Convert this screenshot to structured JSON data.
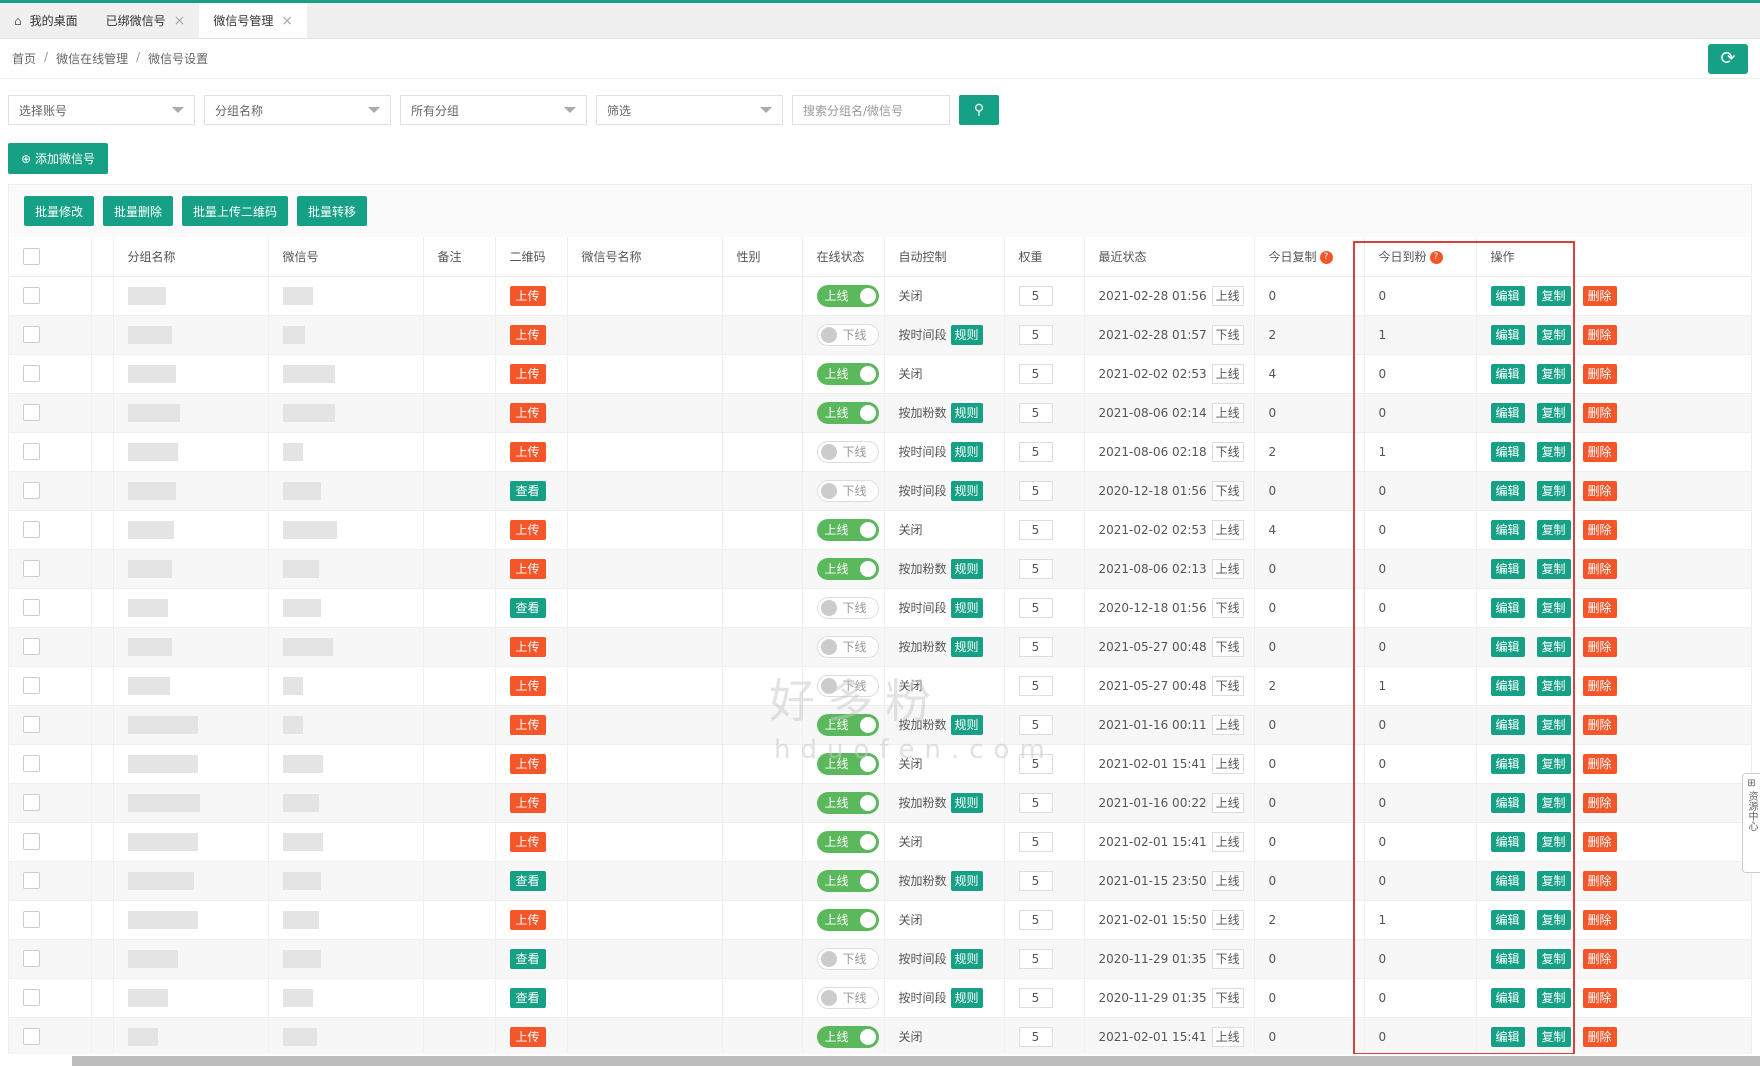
{
  "tabs": [
    {
      "label": "我的桌面",
      "icon": "home-icon",
      "closable": false,
      "active": false
    },
    {
      "label": "已绑微信号",
      "closable": true,
      "active": false
    },
    {
      "label": "微信号管理",
      "closable": true,
      "active": true
    }
  ],
  "breadcrumb": [
    "首页",
    "微信在线管理",
    "微信号设置"
  ],
  "filters": {
    "account": "选择账号",
    "group_name": "分组名称",
    "all_groups": "所有分组",
    "filter": "筛选",
    "search_placeholder": "搜索分组名/微信号"
  },
  "add_button": "添加微信号",
  "batch": {
    "edit": "批量修改",
    "delete": "批量删除",
    "upload_qr": "批量上传二维码",
    "transfer": "批量转移"
  },
  "columns": {
    "group": "分组名称",
    "wechat": "微信号",
    "remark": "备注",
    "qr": "二维码",
    "name": "微信号名称",
    "gender": "性别",
    "online": "在线状态",
    "auto": "自动控制",
    "weight": "权重",
    "recent": "最近状态",
    "today_copy": "今日复制",
    "today_fans": "今日到粉",
    "ops": "操作"
  },
  "labels": {
    "rule": "规则",
    "edit": "编辑",
    "copy": "复制",
    "delete": "删除",
    "upload": "上传",
    "view": "查看",
    "online": "上线",
    "offline": "下线"
  },
  "watermark": {
    "cn": "好多粉",
    "en": "hduofen.com"
  },
  "side_widget": "资源中心",
  "rows": [
    {
      "qr": "上传",
      "online": "上线",
      "auto": "关闭",
      "rule": false,
      "weight": "5",
      "time": "2021-02-28 01:56",
      "status": "上线",
      "copy": "0",
      "fans": "0"
    },
    {
      "qr": "上传",
      "online": "下线",
      "auto": "按时间段",
      "rule": true,
      "weight": "5",
      "time": "2021-02-28 01:57",
      "status": "下线",
      "copy": "2",
      "fans": "1"
    },
    {
      "qr": "上传",
      "online": "上线",
      "auto": "关闭",
      "rule": false,
      "weight": "5",
      "time": "2021-02-02 02:53",
      "status": "上线",
      "copy": "4",
      "fans": "0"
    },
    {
      "qr": "上传",
      "online": "上线",
      "auto": "按加粉数",
      "rule": true,
      "weight": "5",
      "time": "2021-08-06 02:14",
      "status": "上线",
      "copy": "0",
      "fans": "0"
    },
    {
      "qr": "上传",
      "online": "下线",
      "auto": "按时间段",
      "rule": true,
      "weight": "5",
      "time": "2021-08-06 02:18",
      "status": "下线",
      "copy": "2",
      "fans": "1"
    },
    {
      "qr": "查看",
      "online": "下线",
      "auto": "按时间段",
      "rule": true,
      "weight": "5",
      "time": "2020-12-18 01:56",
      "status": "下线",
      "copy": "0",
      "fans": "0"
    },
    {
      "qr": "上传",
      "online": "上线",
      "auto": "关闭",
      "rule": false,
      "weight": "5",
      "time": "2021-02-02 02:53",
      "status": "上线",
      "copy": "4",
      "fans": "0"
    },
    {
      "qr": "上传",
      "online": "上线",
      "auto": "按加粉数",
      "rule": true,
      "weight": "5",
      "time": "2021-08-06 02:13",
      "status": "上线",
      "copy": "0",
      "fans": "0"
    },
    {
      "qr": "查看",
      "online": "下线",
      "auto": "按时间段",
      "rule": true,
      "weight": "5",
      "time": "2020-12-18 01:56",
      "status": "下线",
      "copy": "0",
      "fans": "0"
    },
    {
      "qr": "上传",
      "online": "下线",
      "auto": "按加粉数",
      "rule": true,
      "weight": "5",
      "time": "2021-05-27 00:48",
      "status": "下线",
      "copy": "0",
      "fans": "0"
    },
    {
      "qr": "上传",
      "online": "下线",
      "auto": "关闭",
      "rule": false,
      "weight": "5",
      "time": "2021-05-27 00:48",
      "status": "下线",
      "copy": "2",
      "fans": "1"
    },
    {
      "qr": "上传",
      "online": "上线",
      "auto": "按加粉数",
      "rule": true,
      "weight": "5",
      "time": "2021-01-16 00:11",
      "status": "上线",
      "copy": "0",
      "fans": "0"
    },
    {
      "qr": "上传",
      "online": "上线",
      "auto": "关闭",
      "rule": false,
      "weight": "5",
      "time": "2021-02-01 15:41",
      "status": "上线",
      "copy": "0",
      "fans": "0"
    },
    {
      "qr": "上传",
      "online": "上线",
      "auto": "按加粉数",
      "rule": true,
      "weight": "5",
      "time": "2021-01-16 00:22",
      "status": "上线",
      "copy": "0",
      "fans": "0"
    },
    {
      "qr": "上传",
      "online": "上线",
      "auto": "关闭",
      "rule": false,
      "weight": "5",
      "time": "2021-02-01 15:41",
      "status": "上线",
      "copy": "0",
      "fans": "0"
    },
    {
      "qr": "查看",
      "online": "上线",
      "auto": "按加粉数",
      "rule": true,
      "weight": "5",
      "time": "2021-01-15 23:50",
      "status": "上线",
      "copy": "0",
      "fans": "0"
    },
    {
      "qr": "上传",
      "online": "上线",
      "auto": "关闭",
      "rule": false,
      "weight": "5",
      "time": "2021-02-01 15:50",
      "status": "上线",
      "copy": "2",
      "fans": "1"
    },
    {
      "qr": "查看",
      "online": "下线",
      "auto": "按时间段",
      "rule": true,
      "weight": "5",
      "time": "2020-11-29 01:35",
      "status": "下线",
      "copy": "0",
      "fans": "0"
    },
    {
      "qr": "查看",
      "online": "下线",
      "auto": "按时间段",
      "rule": true,
      "weight": "5",
      "time": "2020-11-29 01:35",
      "status": "下线",
      "copy": "0",
      "fans": "0"
    },
    {
      "qr": "上传",
      "online": "上线",
      "auto": "关闭",
      "rule": false,
      "weight": "5",
      "time": "2021-02-01 15:41",
      "status": "上线",
      "copy": "0",
      "fans": "0"
    }
  ]
}
